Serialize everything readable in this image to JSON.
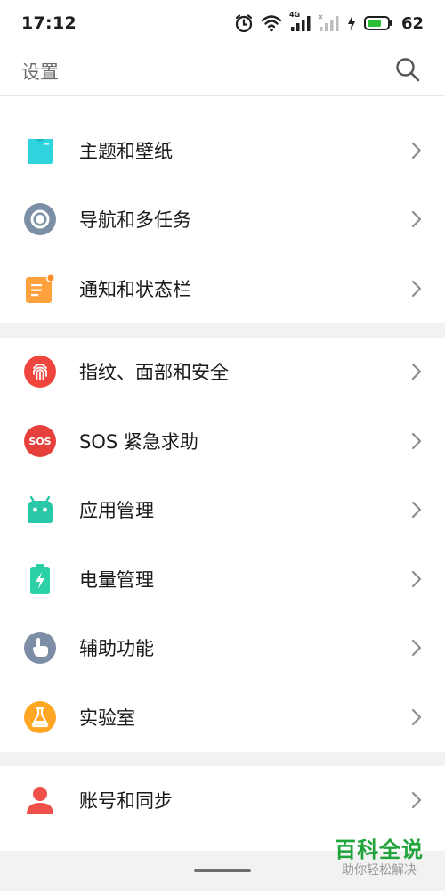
{
  "status_bar": {
    "time": "17:12",
    "signal_type": "4G",
    "battery_level": "62",
    "icons": [
      "alarm-icon",
      "wifi-icon",
      "signal-4g-icon",
      "signal-no-sim-icon",
      "charging-icon",
      "battery-icon"
    ]
  },
  "header": {
    "title": "设置",
    "search_icon": "search-icon"
  },
  "groups": [
    {
      "items": [
        {
          "label": "主题和壁纸",
          "icon": "theme-shirt-icon",
          "color": "#2fd4df"
        },
        {
          "label": "导航和多任务",
          "icon": "navigation-circle-icon",
          "color": "#7b8fa5"
        },
        {
          "label": "通知和状态栏",
          "icon": "notification-icon",
          "color": "#ffa13c"
        }
      ]
    },
    {
      "items": [
        {
          "label": "指纹、面部和安全",
          "icon": "fingerprint-icon",
          "color": "#f0453d"
        },
        {
          "label": "SOS 紧急求助",
          "icon": "sos-icon",
          "icon_text": "SOS",
          "color": "#e6403c"
        },
        {
          "label": "应用管理",
          "icon": "android-icon",
          "color": "#29c8a8"
        },
        {
          "label": "电量管理",
          "icon": "battery-charge-icon",
          "color": "#2bd1a5"
        },
        {
          "label": "辅助功能",
          "icon": "hand-pointer-icon",
          "color": "#7c8ea6"
        },
        {
          "label": "实验室",
          "icon": "flask-icon",
          "color": "#ffa624"
        }
      ]
    },
    {
      "items": [
        {
          "label": "账号和同步",
          "icon": "account-icon",
          "color": "#f0504a"
        }
      ]
    }
  ],
  "watermark": {
    "main": "百科全说",
    "sub": "助你轻松解决"
  }
}
